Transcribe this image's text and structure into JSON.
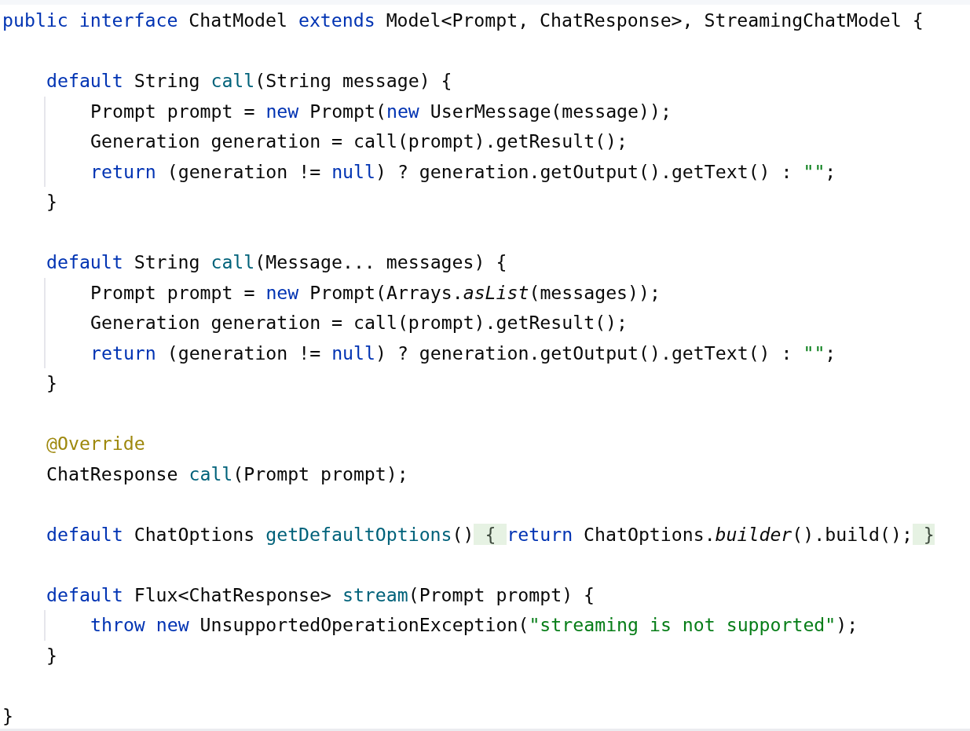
{
  "editor": {
    "lines": [
      {
        "kind": "top",
        "tokens": [
          {
            "kind": "keyword",
            "text": "public interface"
          },
          {
            "kind": "plain",
            "text": " ChatModel "
          },
          {
            "kind": "keyword",
            "text": "extends"
          },
          {
            "kind": "plain",
            "text": " Model<Prompt, ChatResponse>, StreamingChatModel {"
          }
        ]
      },
      {
        "kind": "blank"
      },
      {
        "kind": "member",
        "tokens": [
          {
            "kind": "keyword",
            "text": "default"
          },
          {
            "kind": "plain",
            "text": " String "
          },
          {
            "kind": "method",
            "text": "call"
          },
          {
            "kind": "plain",
            "text": "(String message) {"
          }
        ]
      },
      {
        "kind": "body",
        "tokens": [
          {
            "kind": "plain",
            "text": "Prompt prompt = "
          },
          {
            "kind": "keyword",
            "text": "new"
          },
          {
            "kind": "plain",
            "text": " Prompt("
          },
          {
            "kind": "keyword",
            "text": "new"
          },
          {
            "kind": "plain",
            "text": " UserMessage(message));"
          }
        ]
      },
      {
        "kind": "body",
        "tokens": [
          {
            "kind": "plain",
            "text": "Generation generation = call(prompt).getResult();"
          }
        ]
      },
      {
        "kind": "body",
        "tokens": [
          {
            "kind": "keyword",
            "text": "return"
          },
          {
            "kind": "plain",
            "text": " (generation != "
          },
          {
            "kind": "keyword",
            "text": "null"
          },
          {
            "kind": "plain",
            "text": ") ? generation.getOutput().getText() : "
          },
          {
            "kind": "string",
            "text": "\"\""
          },
          {
            "kind": "plain",
            "text": ";"
          }
        ]
      },
      {
        "kind": "member",
        "tokens": [
          {
            "kind": "plain",
            "text": "}"
          }
        ]
      },
      {
        "kind": "blank"
      },
      {
        "kind": "member",
        "tokens": [
          {
            "kind": "keyword",
            "text": "default"
          },
          {
            "kind": "plain",
            "text": " String "
          },
          {
            "kind": "method",
            "text": "call"
          },
          {
            "kind": "plain",
            "text": "(Message... messages) {"
          }
        ]
      },
      {
        "kind": "body",
        "tokens": [
          {
            "kind": "plain",
            "text": "Prompt prompt = "
          },
          {
            "kind": "keyword",
            "text": "new"
          },
          {
            "kind": "plain",
            "text": " Prompt(Arrays."
          },
          {
            "kind": "italic",
            "text": "asList"
          },
          {
            "kind": "plain",
            "text": "(messages));"
          }
        ]
      },
      {
        "kind": "body",
        "tokens": [
          {
            "kind": "plain",
            "text": "Generation generation = call(prompt).getResult();"
          }
        ]
      },
      {
        "kind": "body",
        "tokens": [
          {
            "kind": "keyword",
            "text": "return"
          },
          {
            "kind": "plain",
            "text": " (generation != "
          },
          {
            "kind": "keyword",
            "text": "null"
          },
          {
            "kind": "plain",
            "text": ") ? generation.getOutput().getText() : "
          },
          {
            "kind": "string",
            "text": "\"\""
          },
          {
            "kind": "plain",
            "text": ";"
          }
        ]
      },
      {
        "kind": "member",
        "tokens": [
          {
            "kind": "plain",
            "text": "}"
          }
        ]
      },
      {
        "kind": "blank"
      },
      {
        "kind": "member",
        "tokens": [
          {
            "kind": "annotation",
            "text": "@Override"
          }
        ]
      },
      {
        "kind": "member",
        "tokens": [
          {
            "kind": "plain",
            "text": "ChatResponse "
          },
          {
            "kind": "method",
            "text": "call"
          },
          {
            "kind": "plain",
            "text": "(Prompt prompt);"
          }
        ]
      },
      {
        "kind": "blank"
      },
      {
        "kind": "member",
        "tokens": [
          {
            "kind": "keyword",
            "text": "default"
          },
          {
            "kind": "plain",
            "text": " ChatOptions "
          },
          {
            "kind": "method",
            "text": "getDefaultOptions"
          },
          {
            "kind": "plain",
            "text": "()"
          },
          {
            "kind": "fold",
            "text": " { "
          },
          {
            "kind": "keyword",
            "text": "return"
          },
          {
            "kind": "plain",
            "text": " ChatOptions."
          },
          {
            "kind": "italic",
            "text": "builder"
          },
          {
            "kind": "plain",
            "text": "().build();"
          },
          {
            "kind": "fold",
            "text": " }"
          }
        ]
      },
      {
        "kind": "blank"
      },
      {
        "kind": "member",
        "tokens": [
          {
            "kind": "keyword",
            "text": "default"
          },
          {
            "kind": "plain",
            "text": " Flux<ChatResponse> "
          },
          {
            "kind": "method",
            "text": "stream"
          },
          {
            "kind": "plain",
            "text": "(Prompt prompt) {"
          }
        ]
      },
      {
        "kind": "body",
        "tokens": [
          {
            "kind": "keyword",
            "text": "throw new"
          },
          {
            "kind": "plain",
            "text": " UnsupportedOperationException("
          },
          {
            "kind": "string",
            "text": "\"streaming is not supported\""
          },
          {
            "kind": "plain",
            "text": ");"
          }
        ]
      },
      {
        "kind": "member",
        "tokens": [
          {
            "kind": "plain",
            "text": "}"
          }
        ]
      },
      {
        "kind": "blank"
      },
      {
        "kind": "top",
        "tokens": [
          {
            "kind": "plain",
            "text": "}"
          }
        ]
      }
    ]
  }
}
